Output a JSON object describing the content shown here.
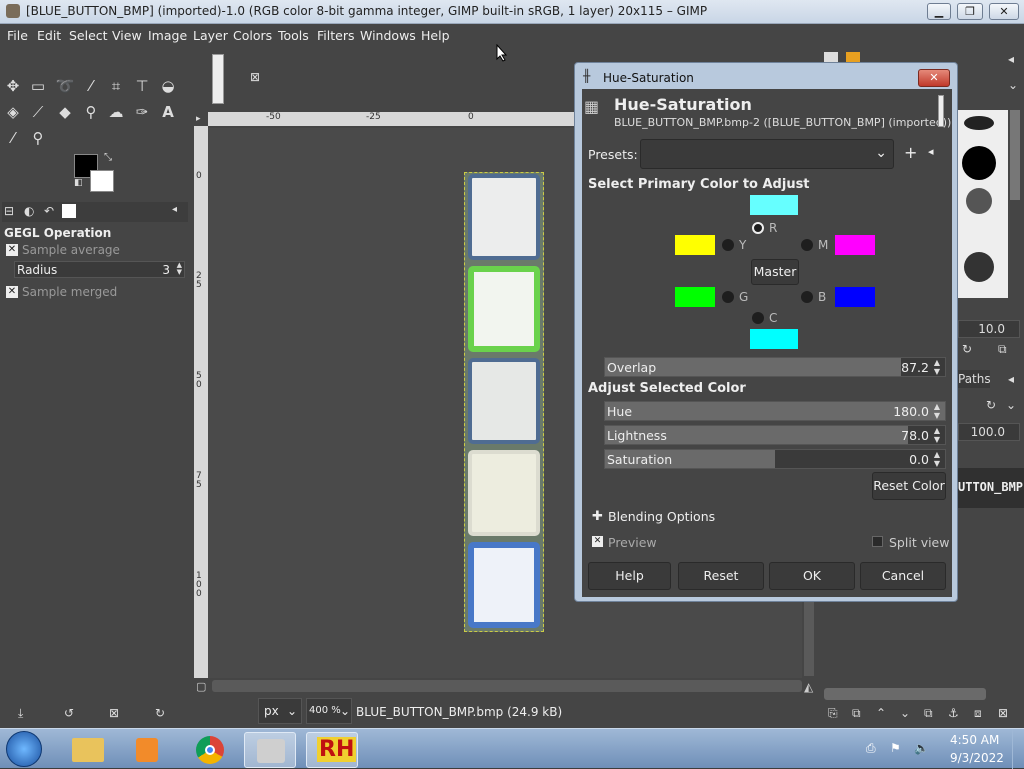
{
  "window": {
    "title": "[BLUE_BUTTON_BMP] (imported)-1.0 (RGB color 8-bit gamma integer, GIMP built-in sRGB, 1 layer) 20x115 – GIMP",
    "min": "▁",
    "max": "❐",
    "close": "✕"
  },
  "menu": [
    "File",
    "Edit",
    "Select",
    "View",
    "Image",
    "Layer",
    "Colors",
    "Tools",
    "Filters",
    "Windows",
    "Help"
  ],
  "toolbox": {
    "tab_close": "⊠",
    "panel_title": "GEGL Operation",
    "sample_average": "Sample average",
    "radius_label": "Radius",
    "radius_value": "3",
    "sample_merged": "Sample merged"
  },
  "ruler": {
    "ticks": [
      "-50",
      "-25",
      "0"
    ],
    "vticks": [
      "0",
      "2 5",
      "5 0",
      "7 5",
      "1 0 0"
    ]
  },
  "statusbar": {
    "unit": "px",
    "zoom": "400 %",
    "file": "BLUE_BUTTON_BMP.bmp (24.9 kB)"
  },
  "dialog": {
    "titlebar": "Hue-Saturation",
    "close": "✕",
    "heading": "Hue-Saturation",
    "subheading": "BLUE_BUTTON_BMP.bmp-2 ([BLUE_BUTTON_BMP] (imported))",
    "presets_label": "Presets:",
    "presets_value": "",
    "select_primary": "Select Primary Color to Adjust",
    "master": "Master",
    "r": "R",
    "y": "Y",
    "m": "M",
    "g": "G",
    "b": "B",
    "c": "C",
    "overlap": {
      "label": "Overlap",
      "value": "87.2",
      "fraction": 0.872
    },
    "adjust_selected": "Adjust Selected Color",
    "hue": {
      "label": "Hue",
      "value": "180.0",
      "fraction": 1.0
    },
    "lightness": {
      "label": "Lightness",
      "value": "78.0",
      "fraction": 0.89
    },
    "saturation": {
      "label": "Saturation",
      "value": "0.0",
      "fraction": 0.5
    },
    "reset_color": "Reset Color",
    "blending": "Blending Options",
    "preview": "Preview",
    "split_view": "Split view",
    "buttons": {
      "help": "Help",
      "reset": "Reset",
      "ok": "OK",
      "cancel": "Cancel"
    },
    "colors": {
      "r": "#66ffff",
      "y": "#ffff00",
      "m": "#ff00ff",
      "g": "#00ff00",
      "b": "#0000ff",
      "c": "#00ffff"
    }
  },
  "rightdock": {
    "val1": "10.0",
    "paths_tab": "Paths",
    "val2": "100.0",
    "layer_name": "UTTON_BMP"
  },
  "taskbar": {
    "time": "4:50 AM",
    "date": "9/3/2022",
    "rh": "RH"
  }
}
